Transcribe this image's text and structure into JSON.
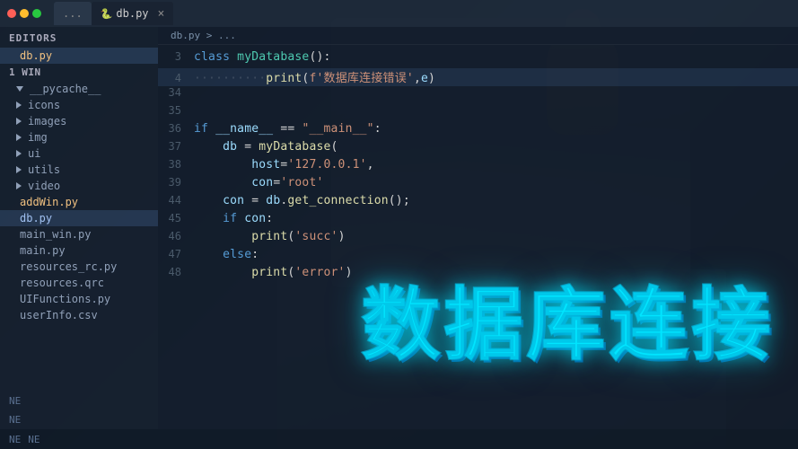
{
  "titlebar": {
    "dots": [
      "red",
      "yellow",
      "green"
    ],
    "inactive_tab": "...",
    "active_tab_icon": "🐍",
    "active_tab_label": "db.py",
    "active_tab_close": "×"
  },
  "sidebar": {
    "editors_label": "EDITORS",
    "editors_file": "db.py",
    "win_label": "1 WIN",
    "folders": [
      "__pycache__",
      "icons",
      "images",
      "img",
      "ui",
      "utils",
      "video"
    ],
    "files": [
      "addWin.py",
      "db.py",
      "main_win.py",
      "main.py",
      "resources_rc.py",
      "resources.qrc",
      "UIFunctions.py",
      "userInfo.csv"
    ],
    "bottom_items": [
      "NE",
      "NE"
    ]
  },
  "breadcrumb": "db.py > ...",
  "code": {
    "lines": [
      {
        "num": "3",
        "content": "class myDatabase():"
      },
      {
        "num": "4",
        "content": "··········print(f'数据库连接错误',e)"
      },
      {
        "num": "34",
        "content": ""
      },
      {
        "num": "35",
        "content": ""
      },
      {
        "num": "36",
        "content": "if __name__ == \"__main__\":"
      },
      {
        "num": "37",
        "content": "    db = myDatabase("
      },
      {
        "num": "38",
        "content": "        host='127.0.0.1',"
      },
      {
        "num": "39",
        "content": "        con='root'"
      },
      {
        "num": "44",
        "content": "    con = db.get_connection();"
      },
      {
        "num": "45",
        "content": "    if con:"
      },
      {
        "num": "46",
        "content": "        print('succ')"
      },
      {
        "num": "47",
        "content": "    else:"
      },
      {
        "num": "48",
        "content": "        print('error')"
      }
    ]
  },
  "big_title": {
    "text": "数据库连接"
  },
  "bottom": {
    "item1": "NE",
    "item2": "NE"
  }
}
